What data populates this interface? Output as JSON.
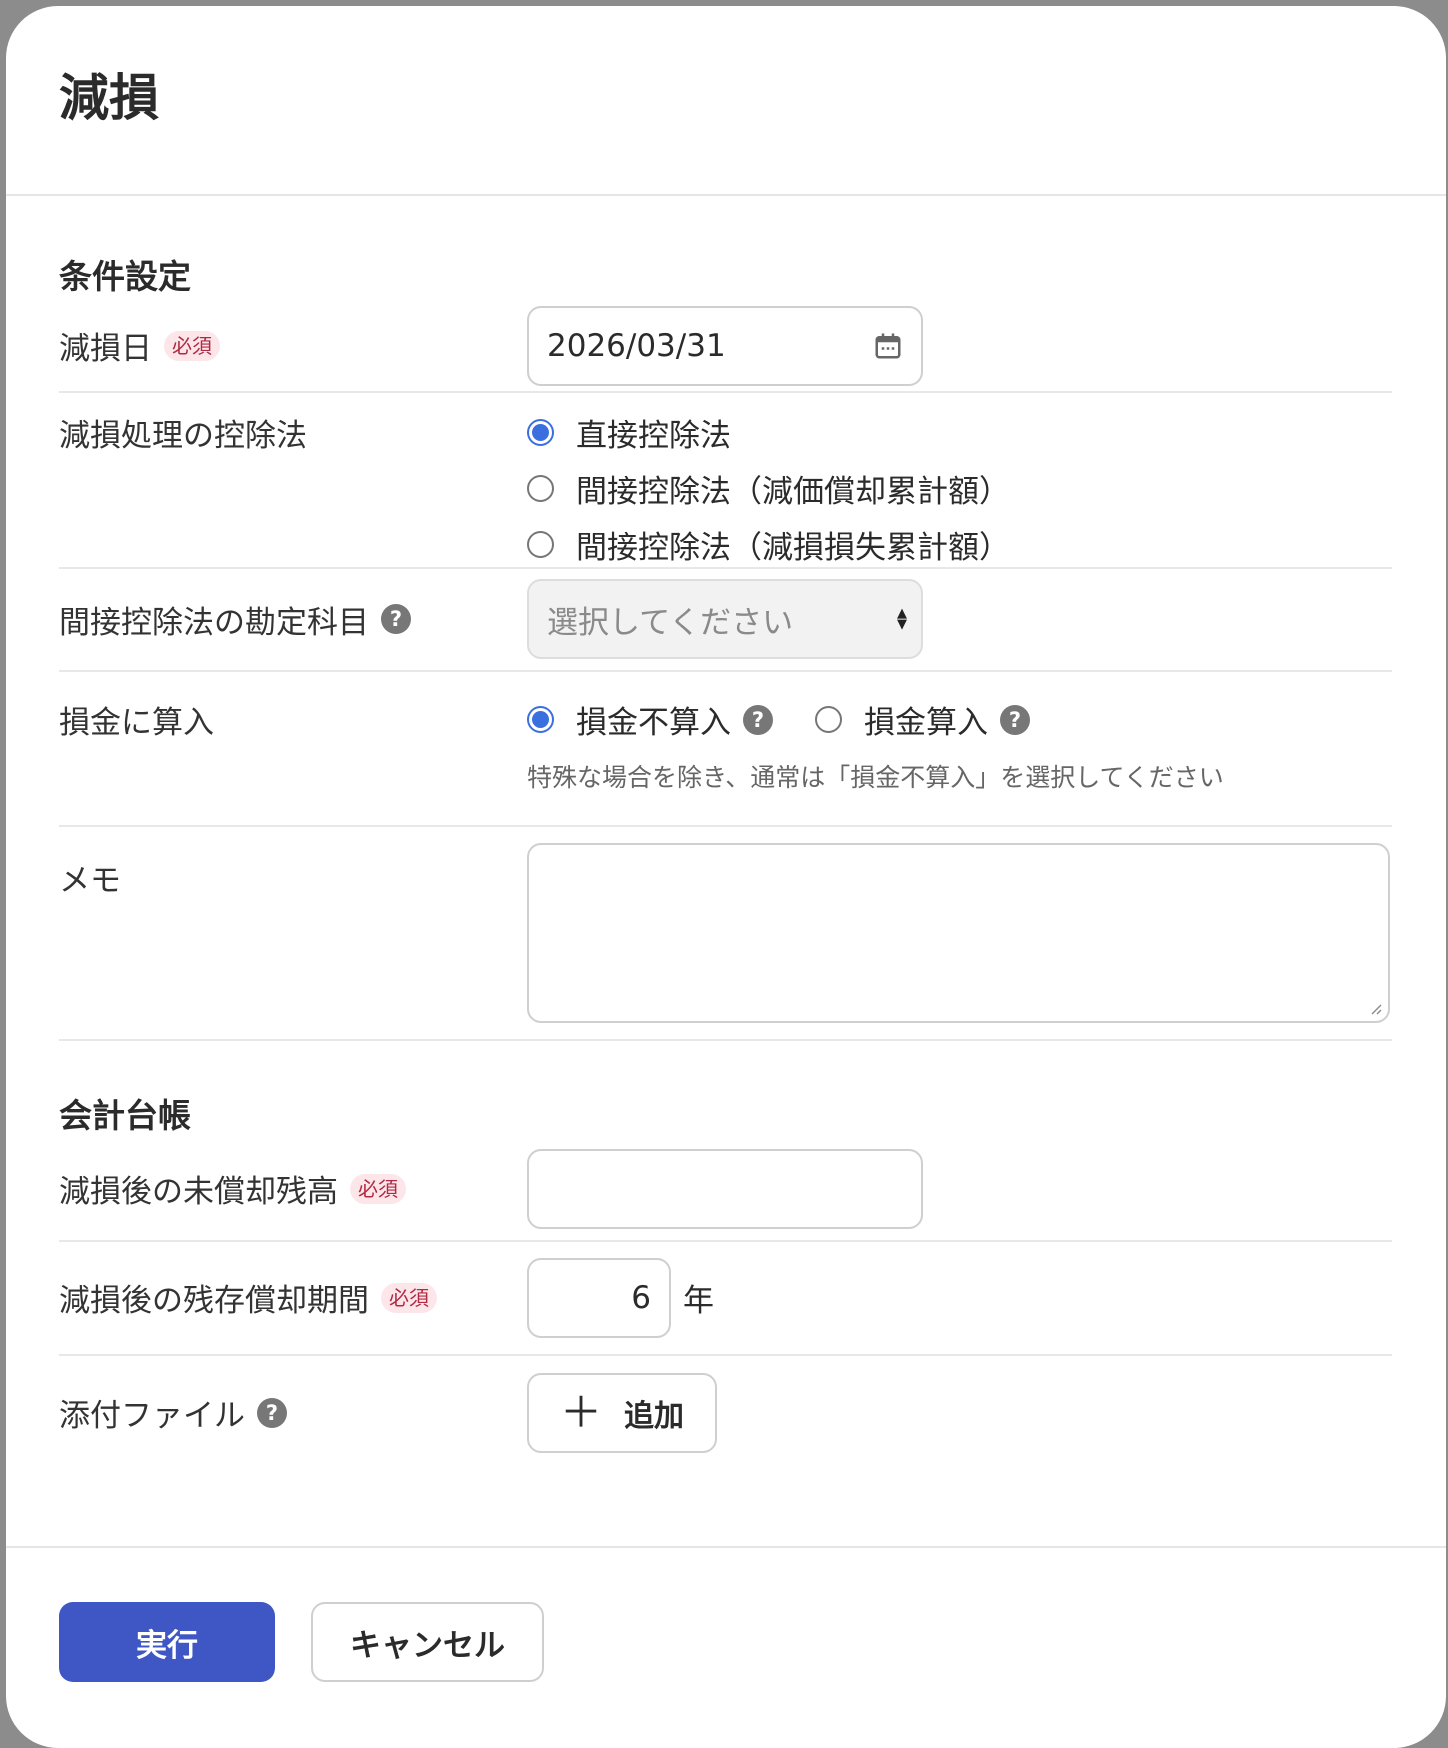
{
  "dialog": {
    "title": "減損"
  },
  "conditions": {
    "section_title": "条件設定",
    "impairment_date": {
      "label": "減損日",
      "badge": "必須",
      "value": "2026/03/31"
    },
    "method": {
      "label": "減損処理の控除法",
      "options": [
        {
          "label": "直接控除法",
          "checked": true
        },
        {
          "label": "間接控除法（減価償却累計額）",
          "checked": false
        },
        {
          "label": "間接控除法（減損損失累計額）",
          "checked": false
        }
      ]
    },
    "indirect_account": {
      "label": "間接控除法の勘定科目",
      "placeholder": "選択してください"
    },
    "deductible": {
      "label": "損金に算入",
      "options": [
        {
          "label": "損金不算入",
          "checked": true
        },
        {
          "label": "損金算入",
          "checked": false
        }
      ],
      "hint": "特殊な場合を除き、通常は「損金不算入」を選択してください"
    },
    "memo": {
      "label": "メモ",
      "value": ""
    }
  },
  "ledger": {
    "section_title": "会計台帳",
    "book_value": {
      "label": "減損後の未償却残高",
      "badge": "必須",
      "value": ""
    },
    "remaining_period": {
      "label": "減損後の残存償却期間",
      "badge": "必須",
      "value": "6",
      "unit": "年"
    },
    "attachment": {
      "label": "添付ファイル",
      "add_label": "追加"
    }
  },
  "help_icon_text": "?",
  "footer": {
    "execute_label": "実行",
    "cancel_label": "キャンセル"
  },
  "colors": {
    "primary": "#3f57c4",
    "radio_checked": "#3b6fe0",
    "badge_bg": "#fde6ea",
    "badge_text": "#b02a43"
  }
}
